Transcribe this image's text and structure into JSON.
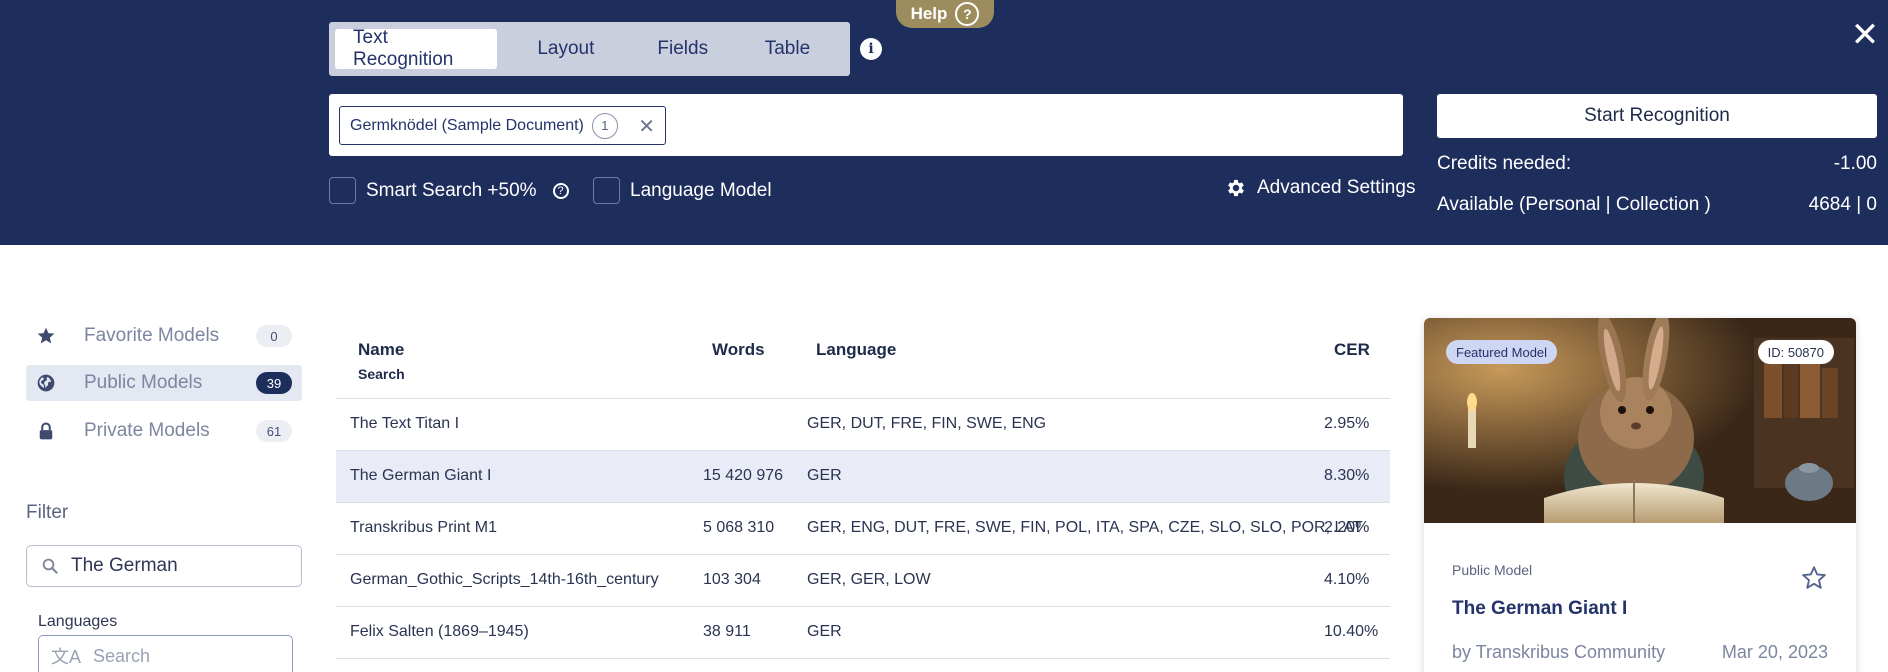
{
  "header": {
    "help_label": "Help",
    "help_glyph": "?",
    "close_glyph": "✕",
    "tabs": [
      {
        "label": "Text Recognition",
        "active": true
      },
      {
        "label": "Layout",
        "active": false
      },
      {
        "label": "Fields",
        "active": false
      },
      {
        "label": "Table",
        "active": false
      }
    ],
    "info_glyph": "i",
    "document_chip": {
      "label": "Germknödel (Sample Document)",
      "count": "1",
      "remove_glyph": "✕"
    },
    "smart_search_label": "Smart Search +50%",
    "smart_search_help": "?",
    "language_model_label": "Language Model",
    "advanced_settings_label": "Advanced Settings",
    "start_button_label": "Start Recognition",
    "credits_needed_label": "Credits needed:",
    "credits_needed_value": "-1.00",
    "available_label": "Available (Personal | Collection )",
    "available_value": "4684 | 0"
  },
  "sidebar": {
    "items": [
      {
        "label": "Favorite Models",
        "count": "0",
        "icon": "star-icon",
        "active": false
      },
      {
        "label": "Public Models",
        "count": "39",
        "icon": "globe-icon",
        "active": true
      },
      {
        "label": "Private Models",
        "count": "61",
        "icon": "lock-icon",
        "active": false
      }
    ],
    "filter_label": "Filter",
    "filter_value": "The German",
    "languages_label": "Languages",
    "languages_placeholder": "Search"
  },
  "table": {
    "headers": {
      "name": "Name",
      "name_sub": "Search",
      "words": "Words",
      "language": "Language",
      "cer": "CER"
    },
    "rows": [
      {
        "name": "The Text Titan I",
        "words": "",
        "language": "GER, DUT, FRE, FIN, SWE, ENG",
        "cer": "2.95%",
        "selected": false
      },
      {
        "name": "The German Giant I",
        "words": "15 420 976",
        "language": "GER",
        "cer": "8.30%",
        "selected": true
      },
      {
        "name": "Transkribus Print M1",
        "words": "5 068 310",
        "language": "GER, ENG, DUT, FRE, SWE, FIN, POL, ITA, SPA, CZE, SLO, SLO, POR, LAT",
        "cer": "2.20%",
        "selected": false
      },
      {
        "name": "German_Gothic_Scripts_14th-16th_century",
        "words": "103 304",
        "language": "GER, GER, LOW",
        "cer": "4.10%",
        "selected": false
      },
      {
        "name": "Felix Salten (1869–1945)",
        "words": "38 911",
        "language": "GER",
        "cer": "10.40%",
        "selected": false
      }
    ]
  },
  "card": {
    "featured_label": "Featured Model",
    "id_label": "ID: 50870",
    "kind": "Public Model",
    "title": "The German Giant I",
    "author": "by Transkribus Community",
    "date": "Mar 20, 2023"
  },
  "colors": {
    "header_bg": "#1d2d5c",
    "help_pill": "#9d8d5e",
    "accent_text": "#24336a",
    "selected_row": "#e9ecf6"
  }
}
